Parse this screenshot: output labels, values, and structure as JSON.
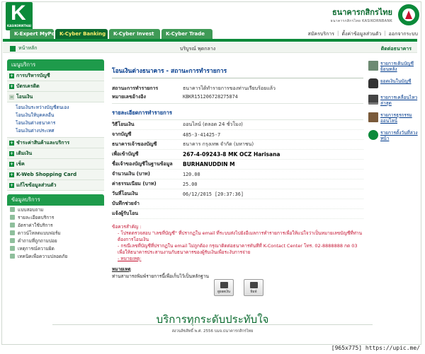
{
  "brand": {
    "logo_letter": "K",
    "logo_text": "KASIKORNTHAI",
    "bank_name_th": "ธนาคารกสิกรไทย",
    "bank_name_en": "ธนาคารกสิกรไทย KASIKORNBANK",
    "accent": "#0b8a3a",
    "dark_green": "#0b6b2f",
    "alert_red": "#c41230",
    "link_blue": "#003a8c"
  },
  "tabs": [
    "K-Expert MyPort",
    "K-Cyber Banking",
    "K-Cyber Invest",
    "K-Cyber Trade"
  ],
  "active_tab": "K-Cyber Banking",
  "top_links": [
    "สมัครบริการ",
    "ตั้งค่าข้อมูลส่วนตัว",
    "ออกจากระบบ"
  ],
  "subbar": {
    "home": "หน้าหลัก",
    "service_center": "บริบูรณ์ พุดกลาง",
    "contact": "ติดต่อธนาคาร"
  },
  "sidebar": {
    "menu_title": "เมนูบริการ",
    "items": [
      {
        "label": "การบริหารบัญชี"
      },
      {
        "label": "บัตรเครดิต"
      },
      {
        "label": "โอนเงิน"
      },
      {
        "label": "ชำระค่าสินค้าและบริการ"
      },
      {
        "label": "เติมเงิน"
      },
      {
        "label": "เช็ค"
      },
      {
        "label": "K-Web Shopping Card"
      },
      {
        "label": "แก้ไขข้อมูลส่วนตัว"
      }
    ],
    "transfer_sub": [
      "โอนเงินระหว่างบัญชีตนเอง",
      "โอนเงินให้บุคคลอื่น",
      "โอนเงินต่างธนาคาร",
      "โอนเงินต่างประเทศ"
    ],
    "svc_title": "ข้อมูลบริการ",
    "svc_items": [
      "แบบสอบถาม",
      "รายละเอียดบริการ",
      "อัตราค่าใช้บริการ",
      "ดาวน์โหลดแบบฟอร์ม",
      "คำถามที่ถูกถามบ่อย",
      "เหตุการณ์ความผิด",
      "เทคนิคเพื่อความปลอดภัย"
    ]
  },
  "main": {
    "title": "โอนเงินต่างธนาคาร - สถานะการทำรายการ",
    "status_label": "สถานะการทำรายการ",
    "status_value": "ธนาคารได้ทำรายการของท่านเรียบร้อยแล้ว",
    "ref_label": "หมายเลขอ้างอิง",
    "ref_value": "KBKR151206728275874",
    "details_title": "รายละเอียดการทำรายการ",
    "details": [
      {
        "label": "วิธีโอนเงิน",
        "value": "ออนไลน์ (ตลอด 24 ชั่วโมง)"
      },
      {
        "label": "จากบัญชี",
        "value": "485-3-41425-7"
      },
      {
        "label": "ธนาคารเจ้าของบัญชี",
        "value": "ธนาคาร กรุงเทพ จำกัด (มหาชน)"
      },
      {
        "label": "เพื่อเข้าบัญชี",
        "value": "267-4-09243-8 MK OCZ Harisana"
      },
      {
        "label": "ชื่อเจ้าของบัญชีในฐานข้อมูล",
        "value": "BURHANUDDIN M"
      },
      {
        "label": "จำนวนเงิน (บาท)",
        "value": "120.00"
      },
      {
        "label": "ค่าธรรมเนียม (บาท)",
        "value": "25.00"
      },
      {
        "label": "วันที่โอนเงิน",
        "value": "06/12/2015 [20:37:36]"
      },
      {
        "label": "บันทึกช่วยจำ",
        "value": ""
      },
      {
        "label": "แจ้งผู้รับโอน",
        "value": ""
      }
    ],
    "note_head": "ข้อควรสำคัญ :",
    "note_1": "- โปรดตรวจสอบ \"เลขที่บัญชี\" ที่ปรากฏใน email ที่ระบบส่งไปยังอีเมลการทำรายการเพื่อให้แน่ใจว่าเป็นหมายเลขบัญชีที่ท่านต้องการโอนเงิน",
    "note_2": "- กรณีเลขที่บัญชีที่ปรากฏใน email ไม่ถูกต้อง กรุณาติดต่อธนาคารทันทีที่ K-Contact Center โทร. 02-8888888 กด 03 เพื่อให้ธนาคารประสานงานกับธนาคารของผู้รับเงินเพื่อระงับการจ่าย",
    "note_3": "- หมายเหตุ:",
    "remark_head": "หมายเหตุ",
    "remark_text": "ท่านสามารถพิมพ์รายการนี้เพื่อเก็บไว้เป็นหลักฐาน",
    "btn_history": "ดูยอดเงิน",
    "btn_print": "พิมพ์"
  },
  "right": [
    "รายการเดินบัญชีย้อนหลัง",
    "ยอดเงินในบัญชี",
    "รายการเคลื่อนไหวล่าสุด",
    "รายการธุรกรรมออนไลน์",
    "รายการตั้งวันที่ล่วงหน้า"
  ],
  "footer": {
    "slogan": "บริการทุกระดับประทับใจ",
    "copyright": "สงวนลิขสิทธิ์ พ.ศ. 2556 บมจ.ธนาคารกสิกรไทย",
    "watermark": "[965x775] https://upic.me/"
  }
}
